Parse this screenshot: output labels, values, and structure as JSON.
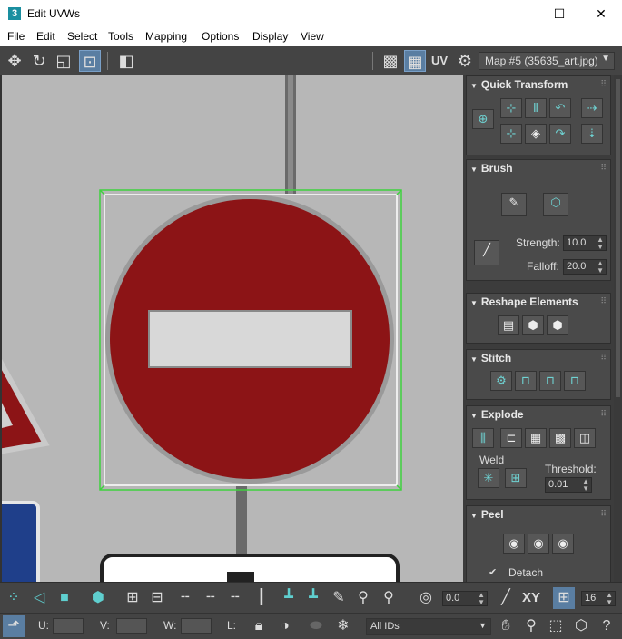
{
  "window": {
    "app_icon_text": "3",
    "title": "Edit UVWs",
    "minimize_glyph": "—",
    "maximize_glyph": "☐",
    "close_glyph": "✕"
  },
  "menu": [
    "File",
    "Edit",
    "Select",
    "Tools",
    "Mapping",
    "Options",
    "Display",
    "View"
  ],
  "toolbar": {
    "uv_label": "UV",
    "map_selected": "Map #5 (35635_art.jpg)"
  },
  "panel": {
    "quick_transform": {
      "title": "Quick Transform"
    },
    "brush": {
      "title": "Brush",
      "strength_label": "Strength:",
      "strength_value": "10.0",
      "falloff_label": "Falloff:",
      "falloff_value": "20.0"
    },
    "reshape": {
      "title": "Reshape Elements"
    },
    "stitch": {
      "title": "Stitch"
    },
    "explode": {
      "title": "Explode",
      "weld_label": "Weld",
      "threshold_label": "Threshold:",
      "threshold_value": "0.01"
    },
    "peel": {
      "title": "Peel",
      "detach_label": "Detach",
      "detach_checked": true
    }
  },
  "bottom": {
    "rotate_value": "0.0",
    "xy_label": "XY",
    "grid_value": "16",
    "u_label": "U:",
    "v_label": "V:",
    "w_label": "W:",
    "l_label": "L:",
    "ids_select": "All IDs"
  },
  "colors": {
    "accent": "#5fcfcf",
    "sign_red": "#8c1416",
    "selection_green": "#3fd23f"
  }
}
